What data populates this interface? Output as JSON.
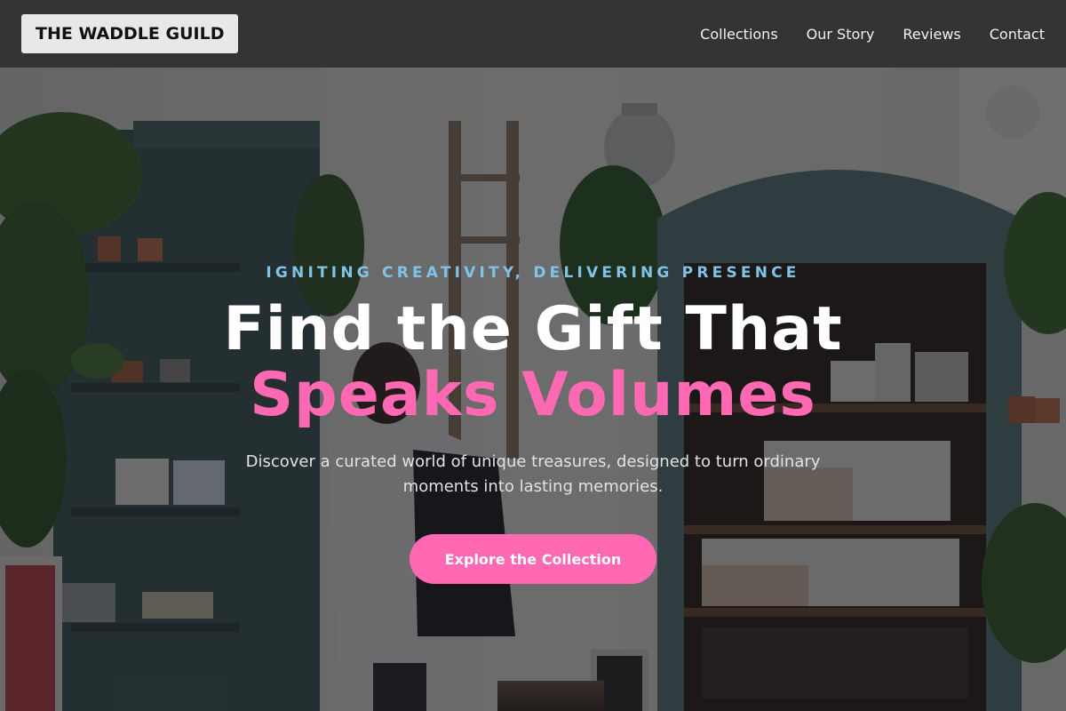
{
  "brand": {
    "name": "THE WADDLE GUILD"
  },
  "nav": {
    "items": [
      {
        "label": "Collections"
      },
      {
        "label": "Our Story"
      },
      {
        "label": "Reviews"
      },
      {
        "label": "Contact"
      }
    ]
  },
  "hero": {
    "eyebrow": "IGNITING CREATIVITY, DELIVERING PRESENCE",
    "headline_line1": "Find the Gift That",
    "headline_line2": "Speaks Volumes",
    "subtitle": "Discover a curated world of unique treasures, designed to turn ordinary moments into lasting memories.",
    "cta_label": "Explore the Collection",
    "background": "gift-shop-interior-photo"
  },
  "colors": {
    "nav_bg": "#333333",
    "accent_pink": "#ff69b4",
    "eyebrow_blue": "#7fc3e6",
    "logo_bg": "#e8e8e8"
  }
}
